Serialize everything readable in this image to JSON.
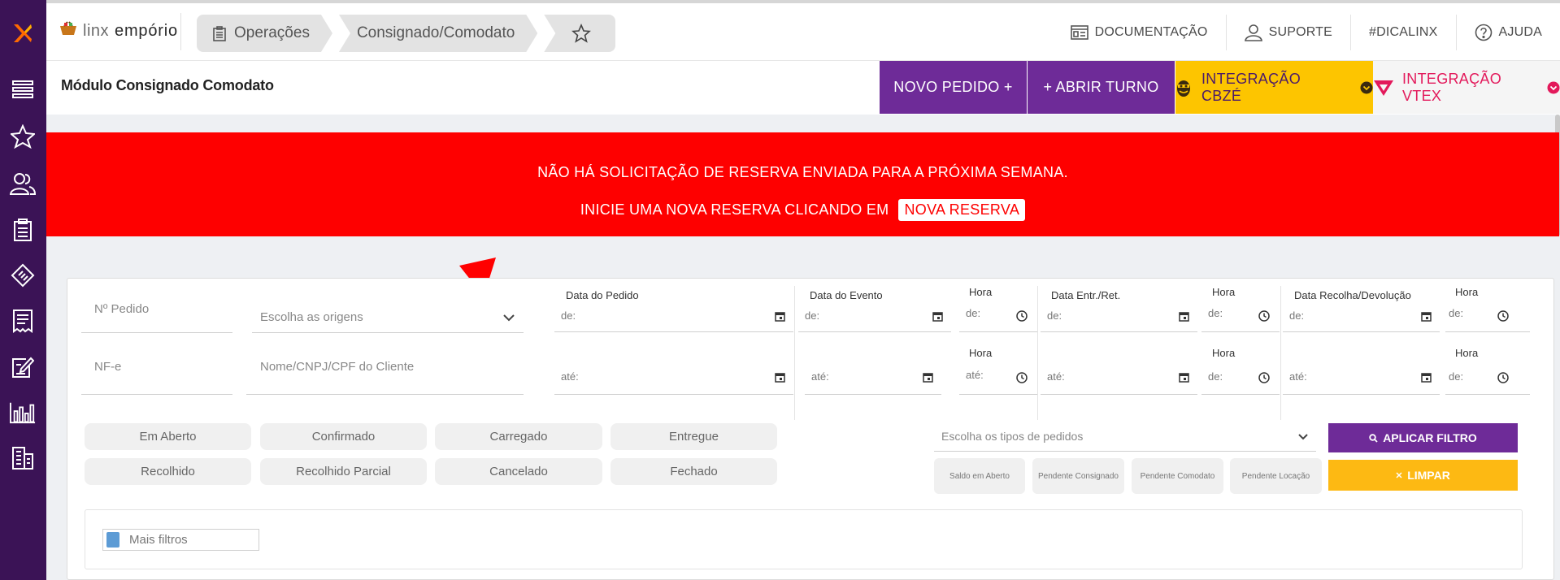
{
  "app": {
    "brand_light": "linx",
    "brand_bold": "empório",
    "colors": {
      "sidebar": "#3b1356",
      "purple": "#6e2b98",
      "yellow": "#fdc500",
      "alert": "#fe0000",
      "vtex": "#e3195b"
    }
  },
  "breadcrumb": {
    "section": "Operações",
    "page": "Consignado/Comodato"
  },
  "toplinks": {
    "documentation": "DOCUMENTAÇÃO",
    "support": "SUPORTE",
    "dicalinx": "#DICALINX",
    "help": "AJUDA"
  },
  "module": {
    "title": "Módulo Consignado Comodato",
    "new_order": "NOVO PEDIDO +",
    "open_shift": "+ ABRIR TURNO",
    "cbze": "INTEGRAÇÃO CBZÉ",
    "vtex": "INTEGRAÇÃO VTEX"
  },
  "alert": {
    "line1": "NÃO HÁ SOLICITAÇÃO DE RESERVA ENVIADA PARA A PRÓXIMA SEMANA.",
    "line2": "INICIE UMA NOVA RESERVA CLICANDO EM",
    "button": "NOVA RESERVA"
  },
  "filters": {
    "order_no_placeholder": "Nº Pedido",
    "origins_placeholder": "Escolha as origens",
    "nfe_placeholder": "NF-e",
    "client_placeholder": "Nome/CNPJ/CPF do Cliente",
    "date_order": "Data do Pedido",
    "date_event": "Data do Evento",
    "date_delivery": "Data Entr./Ret.",
    "date_return": "Data Recolha/Devolução",
    "hour": "Hora",
    "from": "de:",
    "to": "até:",
    "order_types_placeholder": "Escolha os tipos de pedidos",
    "apply": "APLICAR FILTRO",
    "clear": "LIMPAR",
    "more": "Mais filtros"
  },
  "status_pills": [
    "Em Aberto",
    "Confirmado",
    "Carregado",
    "Entregue",
    "Recolhido",
    "Recolhido Parcial",
    "Cancelado",
    "Fechado"
  ],
  "pending_pills": [
    "Saldo em Aberto",
    "Pendente Consignado",
    "Pendente Comodato",
    "Pendente Locação"
  ],
  "sidebar_icons": [
    "menu-icon",
    "star-icon",
    "users-icon",
    "clipboard-icon",
    "ticket-icon",
    "receipt-icon",
    "edit-doc-icon",
    "chart-icon",
    "building-icon"
  ]
}
